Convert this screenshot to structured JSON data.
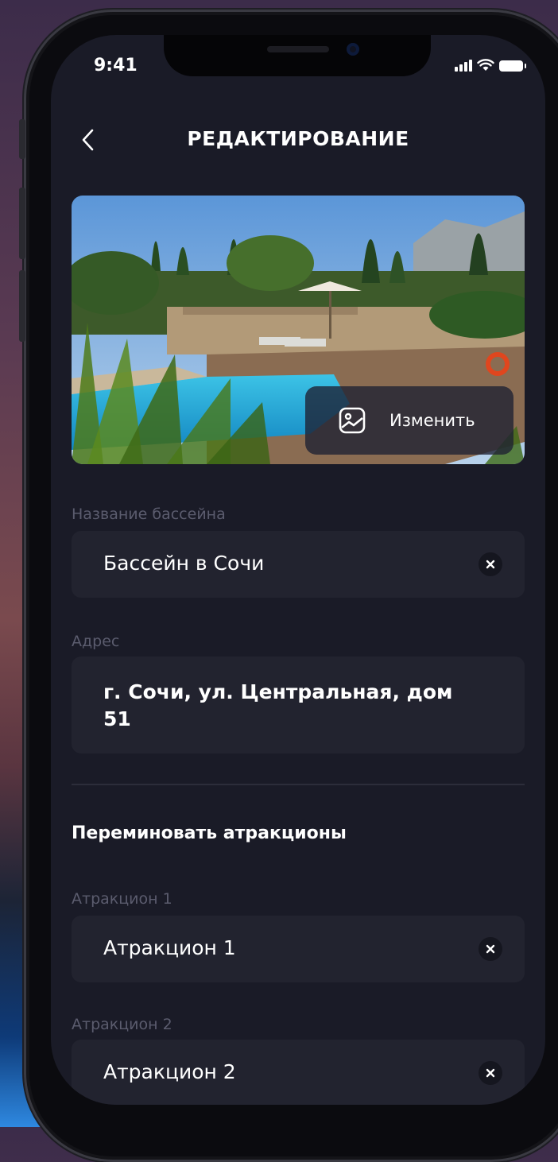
{
  "status_bar": {
    "time": "9:41"
  },
  "header": {
    "title": "РЕДАКТИРОВАНИЕ"
  },
  "photo": {
    "change_label": "Изменить"
  },
  "form": {
    "name_label": "Название бассейна",
    "name_value": "Бассейн в Сочи",
    "address_label": "Адрес",
    "address_line1": "г. Сочи, ул. Центральная, дом",
    "address_line2": "51"
  },
  "attractions": {
    "section_title": "Переминовать атракционы",
    "items": [
      {
        "label": "Атракцион 1",
        "value": "Атракцион 1"
      },
      {
        "label": "Атракцион 2",
        "value": "Атракцион 2"
      }
    ]
  },
  "colors": {
    "background": "#1a1b27",
    "field": "#22232f",
    "label": "#5b5c6e",
    "text": "#ffffff"
  }
}
